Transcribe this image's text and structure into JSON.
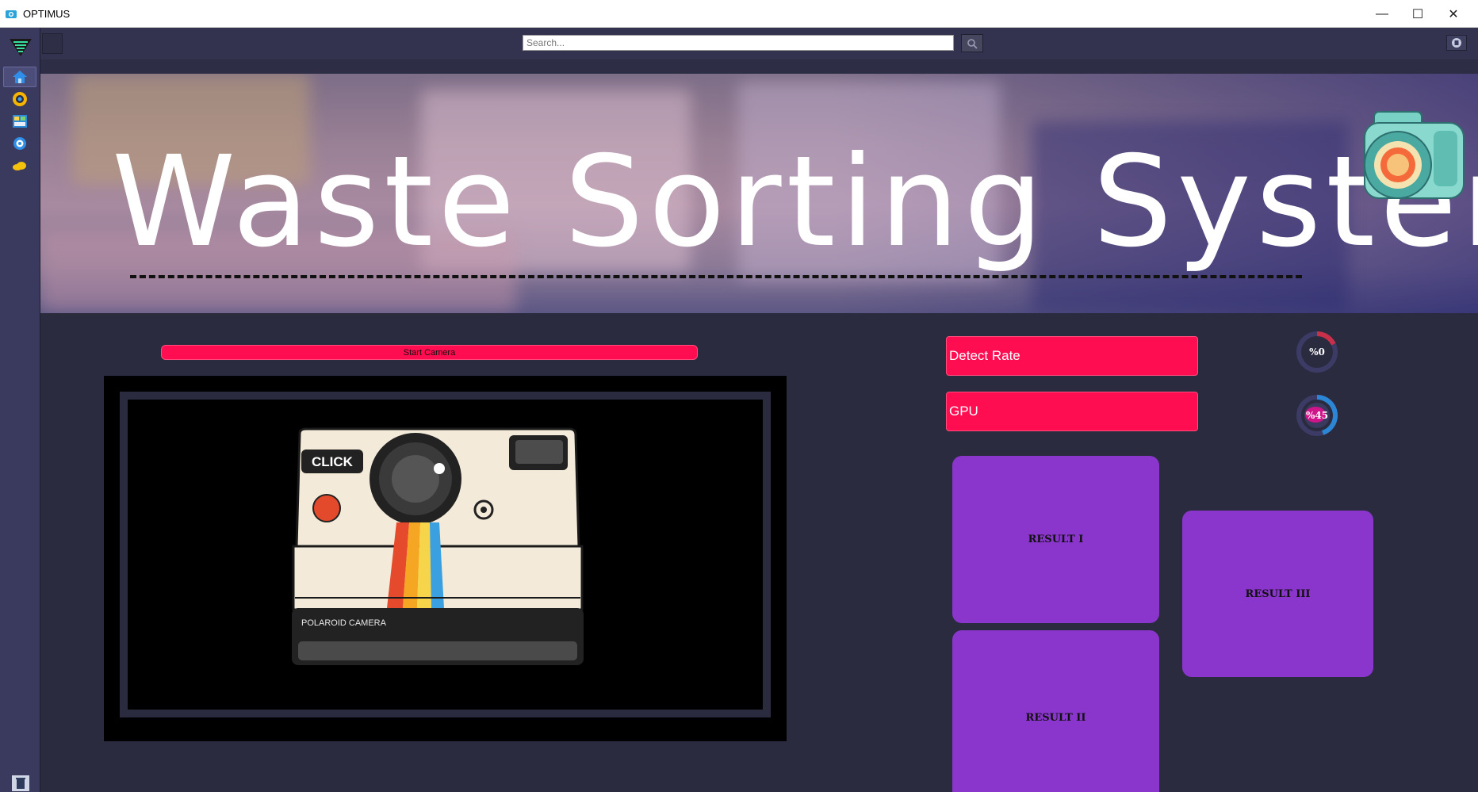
{
  "window": {
    "title": "OPTIMUS",
    "controls": {
      "minimize": "—",
      "maximize": "☐",
      "close": "✕"
    }
  },
  "sidebar": {
    "items": [
      {
        "name": "home",
        "icon": "home-icon",
        "active": true
      },
      {
        "name": "camera",
        "icon": "camera-lens-icon",
        "active": false
      },
      {
        "name": "dashboard",
        "icon": "dashboard-icon",
        "active": false
      },
      {
        "name": "settings",
        "icon": "gear-icon",
        "active": false
      },
      {
        "name": "cloud",
        "icon": "cloud-icon",
        "active": false
      }
    ],
    "bottom_icon": "trash-icon"
  },
  "toolbar": {
    "search_placeholder": "Search...",
    "search_icon": "search-icon",
    "user_icon": "user-icon"
  },
  "banner": {
    "title": "Waste Sorting System",
    "camera_icon": "camera-illustration"
  },
  "camera": {
    "start_label": "Start Camera",
    "placeholder": {
      "click_label": "CLICK",
      "brand_label": "POLAROID CAMERA"
    }
  },
  "stats": {
    "detect_rate_label": "Detect Rate",
    "gpu_label": "GPU",
    "detect_rate_value": 0,
    "detect_rate_text": "%0",
    "gpu_value": 45,
    "gpu_text": "%45"
  },
  "results": {
    "result_1": "RESULT I",
    "result_2": "RESULT II",
    "result_3": "RESULT III"
  },
  "colors": {
    "accent": "#ff0d50",
    "result": "#8a35cb",
    "background": "#2b2b40",
    "sidebar": "#3a3a5e",
    "gauge_track": "#3b3b66",
    "gauge_detect_arc": "#c8304a",
    "gauge_gpu_arc": "#2b86d6",
    "gauge_gpu_center": "#d0148a"
  }
}
